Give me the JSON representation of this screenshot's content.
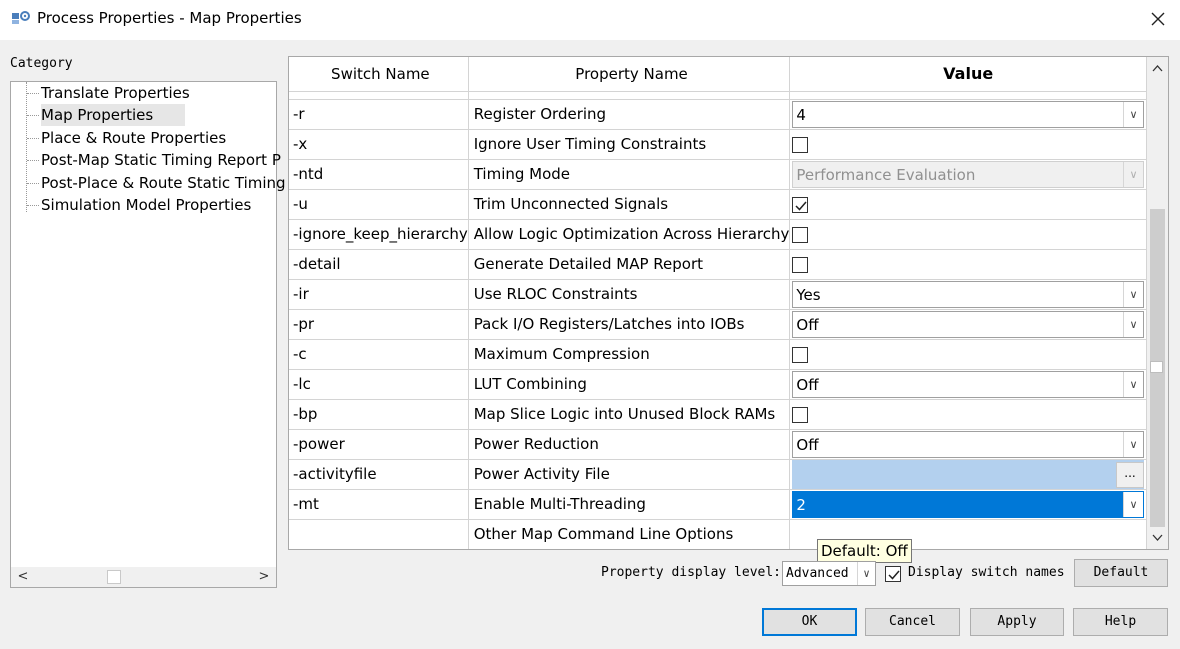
{
  "window": {
    "title": "Process Properties - Map Properties",
    "close_glyph": "✕"
  },
  "sidebar": {
    "label": "Category",
    "items": [
      {
        "label": "Translate Properties"
      },
      {
        "label": "Map Properties",
        "selected": true
      },
      {
        "label": "Place & Route Properties"
      },
      {
        "label": "Post-Map Static Timing Report P"
      },
      {
        "label": "Post-Place & Route Static Timing"
      },
      {
        "label": "Simulation Model Properties"
      }
    ],
    "scroll_left": "<",
    "scroll_right": ">"
  },
  "grid": {
    "headers": {
      "switch": "Switch Name",
      "property": "Property Name",
      "value": "Value"
    },
    "rows": [
      {
        "switch": "-r",
        "property": "Register Ordering",
        "type": "combo",
        "value": "4"
      },
      {
        "switch": "-x",
        "property": "Ignore User Timing Constraints",
        "type": "check",
        "checked": false
      },
      {
        "switch": "-ntd",
        "property": "Timing Mode",
        "type": "combo-disabled",
        "value": "Performance Evaluation"
      },
      {
        "switch": "-u",
        "property": "Trim Unconnected Signals",
        "type": "check",
        "checked": true
      },
      {
        "switch": "-ignore_keep_hierarchy",
        "property": "Allow Logic Optimization Across Hierarchy",
        "type": "check",
        "checked": false
      },
      {
        "switch": "-detail",
        "property": "Generate Detailed MAP Report",
        "type": "check",
        "checked": false
      },
      {
        "switch": "-ir",
        "property": "Use RLOC Constraints",
        "type": "combo",
        "value": "Yes"
      },
      {
        "switch": "-pr",
        "property": "Pack I/O Registers/Latches into IOBs",
        "type": "combo",
        "value": "Off"
      },
      {
        "switch": "-c",
        "property": "Maximum Compression",
        "type": "check",
        "checked": false
      },
      {
        "switch": "-lc",
        "property": "LUT Combining",
        "type": "combo",
        "value": "Off"
      },
      {
        "switch": "-bp",
        "property": "Map Slice Logic into Unused Block RAMs",
        "type": "check",
        "checked": false
      },
      {
        "switch": "-power",
        "property": "Power Reduction",
        "type": "combo",
        "value": "Off"
      },
      {
        "switch": "-activityfile",
        "property": "Power Activity File",
        "type": "file",
        "value": "",
        "button": "..."
      },
      {
        "switch": "-mt",
        "property": "Enable Multi-Threading",
        "type": "combo-selected",
        "value": "2"
      },
      {
        "switch": "",
        "property": "Other Map Command Line Options",
        "type": "text",
        "value": ""
      }
    ]
  },
  "tooltip": "Default: Off",
  "footer": {
    "display_level_label": "Property display level:",
    "display_level_value": "Advanced",
    "display_switch_label": "Display switch names",
    "display_switch_checked": true,
    "default_button": "Default"
  },
  "buttons": {
    "ok": "OK",
    "cancel": "Cancel",
    "apply": "Apply",
    "help": "Help"
  },
  "colors": {
    "selection": "#0078d7",
    "file_field": "#b3d0ee",
    "tooltip_bg": "#ffffe1"
  }
}
